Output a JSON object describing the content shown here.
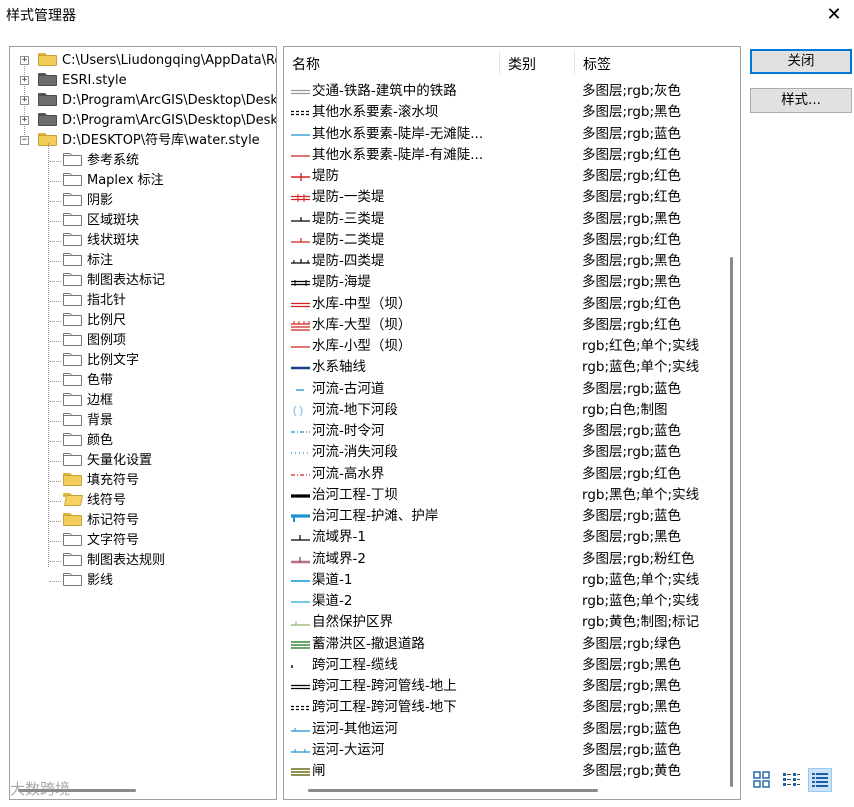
{
  "window": {
    "title": "样式管理器",
    "close_glyph": "✕"
  },
  "tree": {
    "roots": [
      {
        "label": "C:\\Users\\Liudongqing\\AppData\\Ro",
        "folder": "yellow",
        "expander": "+"
      },
      {
        "label": "ESRI.style",
        "folder": "gray",
        "expander": "+"
      },
      {
        "label": "D:\\Program\\ArcGIS\\Desktop\\Desk",
        "folder": "gray",
        "expander": "+"
      },
      {
        "label": "D:\\Program\\ArcGIS\\Desktop\\Desk",
        "folder": "gray",
        "expander": "+"
      },
      {
        "label": "D:\\DESKTOP\\符号库\\water.style",
        "folder": "yellow",
        "expander": "−"
      }
    ],
    "children": [
      {
        "label": "参考系统",
        "folder": "white"
      },
      {
        "label": "Maplex 标注",
        "folder": "white"
      },
      {
        "label": "阴影",
        "folder": "white"
      },
      {
        "label": "区域斑块",
        "folder": "white"
      },
      {
        "label": "线状斑块",
        "folder": "white"
      },
      {
        "label": "标注",
        "folder": "white"
      },
      {
        "label": "制图表达标记",
        "folder": "white"
      },
      {
        "label": "指北针",
        "folder": "white"
      },
      {
        "label": "比例尺",
        "folder": "white"
      },
      {
        "label": "图例项",
        "folder": "white"
      },
      {
        "label": "比例文字",
        "folder": "white"
      },
      {
        "label": "色带",
        "folder": "white"
      },
      {
        "label": "边框",
        "folder": "white"
      },
      {
        "label": "背景",
        "folder": "white"
      },
      {
        "label": "颜色",
        "folder": "white"
      },
      {
        "label": "矢量化设置",
        "folder": "white"
      },
      {
        "label": "填充符号",
        "folder": "yellow"
      },
      {
        "label": "线符号",
        "folder": "open"
      },
      {
        "label": "标记符号",
        "folder": "yellow"
      },
      {
        "label": "文字符号",
        "folder": "white"
      },
      {
        "label": "制图表达规则",
        "folder": "white"
      },
      {
        "label": "影线",
        "folder": "white"
      }
    ]
  },
  "list": {
    "columns": {
      "name": "名称",
      "category": "类别",
      "tags": "标签"
    },
    "rows": [
      {
        "name": "交通-铁路-建筑中的铁路",
        "tags": "多图层;rgb;灰色",
        "icon": "double-line-gray",
        "color": "#9a9a9a"
      },
      {
        "name": "其他水系要素-滚水坝",
        "tags": "多图层;rgb;黑色",
        "icon": "dash-double-black",
        "color": "#000000"
      },
      {
        "name": "其他水系要素-陡岸-无滩陡...",
        "tags": "多图层;rgb;蓝色",
        "icon": "line-blue",
        "color": "#1e90d0"
      },
      {
        "name": "其他水系要素-陡岸-有滩陡...",
        "tags": "多图层;rgb;红色",
        "icon": "line-red",
        "color": "#d42020"
      },
      {
        "name": "堤防",
        "tags": "多图层;rgb;红色",
        "icon": "cross-red",
        "color": "#d42020"
      },
      {
        "name": "堤防-一类堤",
        "tags": "多图层;rgb;红色",
        "icon": "hatch-double-red",
        "color": "#d42020"
      },
      {
        "name": "堤防-三类堤",
        "tags": "多图层;rgb;黑色",
        "icon": "tick-line-black",
        "color": "#000000"
      },
      {
        "name": "堤防-二类堤",
        "tags": "多图层;rgb;红色",
        "icon": "tick-line-red",
        "color": "#d42020"
      },
      {
        "name": "堤防-四类堤",
        "tags": "多图层;rgb;黑色",
        "icon": "tick-line-black2",
        "color": "#000000"
      },
      {
        "name": "堤防-海堤",
        "tags": "多图层;rgb;黑色",
        "icon": "double-hatch-black",
        "color": "#000000"
      },
      {
        "name": "水库-中型（坝）",
        "tags": "多图层;rgb;红色",
        "icon": "double-line-red",
        "color": "#d42020"
      },
      {
        "name": "水库-大型（坝）",
        "tags": "多图层;rgb;红色",
        "icon": "comb-red",
        "color": "#d42020"
      },
      {
        "name": "水库-小型（坝）",
        "tags": "rgb;红色;单个;实线",
        "icon": "line-red",
        "color": "#d42020"
      },
      {
        "name": "水系轴线",
        "tags": "rgb;蓝色;单个;实线",
        "icon": "thick-line-navy",
        "color": "#1a3e8c"
      },
      {
        "name": "河流-古河道",
        "tags": "多图层;rgb;蓝色",
        "icon": "line-blue-short",
        "color": "#1e90d0"
      },
      {
        "name": "河流-地下河段",
        "tags": "rgb;白色;制图",
        "icon": "paren-lightblue",
        "color": "#9ac8e8"
      },
      {
        "name": "河流-时令河",
        "tags": "多图层;rgb;蓝色",
        "icon": "dash-dot-blue",
        "color": "#1e90d0"
      },
      {
        "name": "河流-消失河段",
        "tags": "多图层;rgb;蓝色",
        "icon": "dots-blue",
        "color": "#1e90d0"
      },
      {
        "name": "河流-高水界",
        "tags": "多图层;rgb;红色",
        "icon": "dash-dot-red",
        "color": "#d42020"
      },
      {
        "name": "治河工程-丁坝",
        "tags": "rgb;黑色;单个;实线",
        "icon": "thick-line-black",
        "color": "#000000"
      },
      {
        "name": "治河工程-护滩、护岸",
        "tags": "多图层;rgb;蓝色",
        "icon": "thick-hook-blue",
        "color": "#1e90d0"
      },
      {
        "name": "流域界-1",
        "tags": "多图层;rgb;黑色",
        "icon": "tick-up-black",
        "color": "#000000"
      },
      {
        "name": "流域界-2",
        "tags": "多图层;rgb;粉红色",
        "icon": "tick-pink",
        "color": "#f2a0c0"
      },
      {
        "name": "渠道-1",
        "tags": "rgb;蓝色;单个;实线",
        "icon": "line-skyblue",
        "color": "#2aa6e0"
      },
      {
        "name": "渠道-2",
        "tags": "rgb;蓝色;单个;实线",
        "icon": "line-skyblue-thin",
        "color": "#2aa6e0"
      },
      {
        "name": "自然保护区界",
        "tags": "rgb;黄色;制图;标记",
        "icon": "tick-green",
        "color": "#8fb26a"
      },
      {
        "name": "蓄滞洪区-撤退道路",
        "tags": "多图层;rgb;绿色",
        "icon": "triple-green",
        "color": "#3a8a3a"
      },
      {
        "name": "跨河工程-缆线",
        "tags": "多图层;rgb;黑色",
        "icon": "dot-black",
        "color": "#000000"
      },
      {
        "name": "跨河工程-跨河管线-地上",
        "tags": "多图层;rgb;黑色",
        "icon": "double-line-black",
        "color": "#000000"
      },
      {
        "name": "跨河工程-跨河管线-地下",
        "tags": "多图层;rgb;黑色",
        "icon": "dash-double-black2",
        "color": "#000000"
      },
      {
        "name": "运河-其他运河",
        "tags": "多图层;rgb;蓝色",
        "icon": "tick-blue",
        "color": "#1e90d0"
      },
      {
        "name": "运河-大运河",
        "tags": "多图层;rgb;蓝色",
        "icon": "tick-blue2",
        "color": "#1e90d0"
      },
      {
        "name": "闸",
        "tags": "多图层;rgb;黄色",
        "icon": "triple-olive",
        "color": "#6b6b1a"
      }
    ]
  },
  "buttons": {
    "close": "关闭",
    "styles": "样式..."
  },
  "view_modes": [
    {
      "name": "large-icons-view-icon",
      "selected": false
    },
    {
      "name": "list-view-icon",
      "selected": false
    },
    {
      "name": "details-view-icon",
      "selected": true
    }
  ],
  "watermark": "大数跨境"
}
